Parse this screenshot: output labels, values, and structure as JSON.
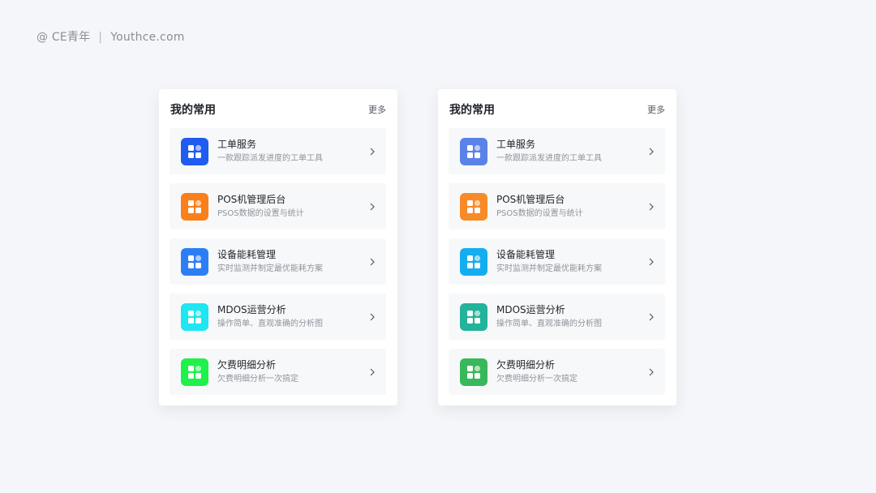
{
  "watermark": {
    "brand": "@ CE青年",
    "separator": "|",
    "site": "Youthce.com"
  },
  "cards": [
    {
      "title": "我的常用",
      "more": "更多",
      "items": [
        {
          "title": "工单服务",
          "desc": "一款跟踪派发进度的工单工具",
          "color": "#1f5cf0"
        },
        {
          "title": "POS机管理后台",
          "desc": "PSOS数据的设置与统计",
          "color": "#fb7f1a"
        },
        {
          "title": "设备能耗管理",
          "desc": "实时监测并制定最优能耗方案",
          "color": "#2d7ef5"
        },
        {
          "title": "MDOS运营分析",
          "desc": "操作简单、直观准确的分析图",
          "color": "#1fe6f0"
        },
        {
          "title": "欠费明细分析",
          "desc": "欠费明细分析一次搞定",
          "color": "#1ff04a"
        }
      ]
    },
    {
      "title": "我的常用",
      "more": "更多",
      "items": [
        {
          "title": "工单服务",
          "desc": "一款跟踪派发进度的工单工具",
          "color": "#5a83e8"
        },
        {
          "title": "POS机管理后台",
          "desc": "PSOS数据的设置与统计",
          "color": "#f98a28"
        },
        {
          "title": "设备能耗管理",
          "desc": "实时监测并制定最优能耗方案",
          "color": "#14aef0"
        },
        {
          "title": "MDOS运营分析",
          "desc": "操作简单、直观准确的分析图",
          "color": "#22b39a"
        },
        {
          "title": "欠费明细分析",
          "desc": "欠费明细分析一次搞定",
          "color": "#38b85a"
        }
      ]
    }
  ],
  "icons": {
    "app": "app-grid-icon",
    "arrow": "chevron-right-icon"
  }
}
